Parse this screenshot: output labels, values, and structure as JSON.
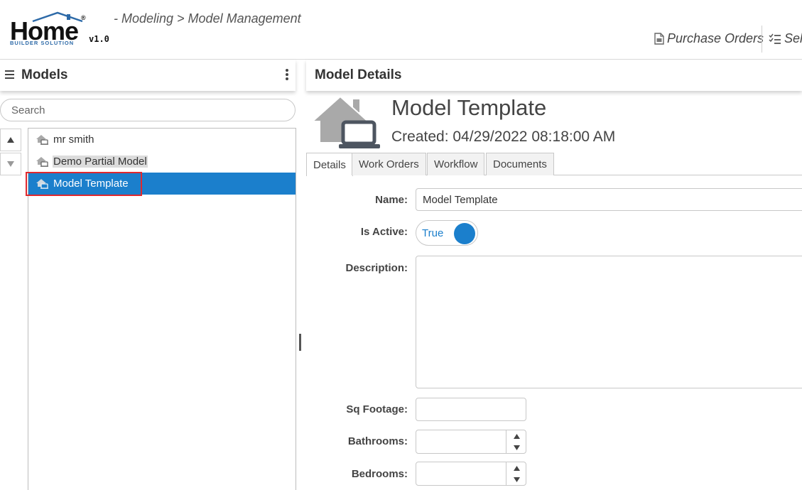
{
  "header": {
    "logo": {
      "word": "Home",
      "subtitle": "BUILDER SOLUTION",
      "version": "v1.0",
      "registered": "®"
    },
    "breadcrumb": "- Modeling > Model Management",
    "links": [
      {
        "label": "Purchase Orders",
        "icon": "document-icon"
      },
      {
        "label": "Sele",
        "icon": "checklist-icon"
      }
    ]
  },
  "left_panel": {
    "title": "Models",
    "search": {
      "placeholder": "Search",
      "value": ""
    },
    "tree_items": [
      {
        "label": "mr smith",
        "state": "normal"
      },
      {
        "label": "Demo Partial Model",
        "state": "hover"
      },
      {
        "label": "Model Template",
        "state": "selected"
      }
    ]
  },
  "right_panel": {
    "title": "Model Details",
    "model_name": "Model Template",
    "created": "Created: 04/29/2022 08:18:00 AM",
    "tabs": [
      {
        "label": "Details",
        "active": true
      },
      {
        "label": "Work Orders",
        "active": false
      },
      {
        "label": "Workflow",
        "active": false
      },
      {
        "label": "Documents",
        "active": false
      }
    ],
    "form": {
      "name_label": "Name:",
      "name_value": "Model Template",
      "active_label": "Is Active:",
      "active_value": "True",
      "description_label": "Description:",
      "description_value": "",
      "sqft_label": "Sq Footage:",
      "sqft_value": "",
      "bathrooms_label": "Bathrooms:",
      "bathrooms_value": "",
      "bedrooms_label": "Bedrooms:",
      "bedrooms_value": ""
    }
  },
  "colors": {
    "accent": "#1b7fcc",
    "selection_outline": "#e0282e",
    "logo_blue": "#2d6aa8",
    "icon_gray": "#a9a9a9"
  }
}
